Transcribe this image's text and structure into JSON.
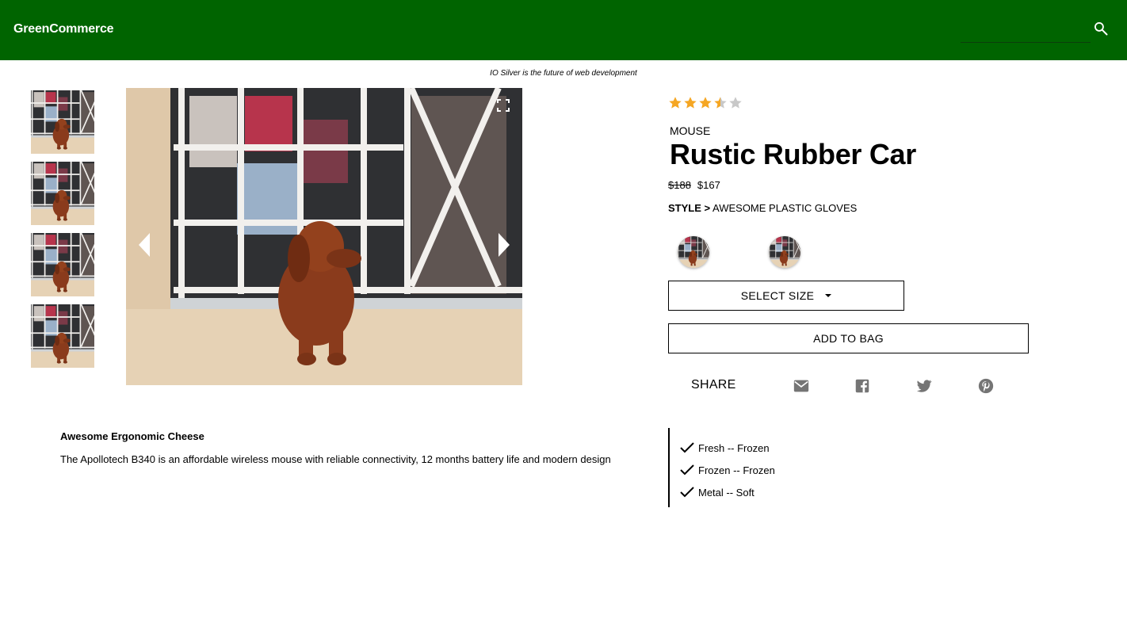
{
  "header": {
    "brand": "GreenCommerce",
    "search_placeholder": "",
    "background": "#006400"
  },
  "tagline": "IO Silver is the future of web development",
  "gallery": {
    "thumbnails": [
      "dog-photo",
      "dog-photo",
      "dog-photo",
      "dog-photo"
    ],
    "prev_icon": "chevron-left-icon",
    "next_icon": "chevron-right-icon",
    "expand_icon": "fullscreen-icon"
  },
  "product": {
    "rating": 3.5,
    "rating_max": 5,
    "star_color": "#f5a623",
    "category": "MOUSE",
    "title": "Rustic Rubber Car",
    "old_price": "$188",
    "price": "$167",
    "style_label": "STYLE >",
    "style_value": "AWESOME PLASTIC GLOVES",
    "swatches": [
      "dog-photo",
      "dog-photo"
    ],
    "select_size_label": "SELECT SIZE",
    "add_to_bag_label": "ADD TO BAG"
  },
  "share": {
    "label": "SHARE",
    "icons": [
      "email-icon",
      "facebook-icon",
      "twitter-icon",
      "pinterest-icon"
    ],
    "icon_color": "#757575"
  },
  "description": {
    "title": "Awesome Ergonomic Cheese",
    "text": "The Apollotech B340 is an affordable wireless mouse with reliable connectivity, 12 months battery life and modern design"
  },
  "features": [
    "Fresh -- Frozen",
    "Frozen -- Frozen",
    "Metal -- Soft"
  ]
}
